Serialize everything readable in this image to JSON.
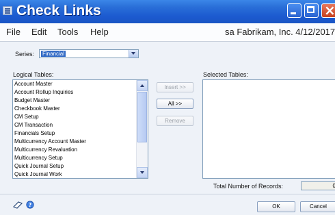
{
  "window": {
    "title": "Check Links"
  },
  "menu": {
    "items": [
      "File",
      "Edit",
      "Tools",
      "Help"
    ],
    "company_date": "sa Fabrikam, Inc. 4/12/2017"
  },
  "series": {
    "label": "Series:",
    "value": "Financial"
  },
  "logical_tables": {
    "label": "Logical Tables:",
    "items": [
      "Account Master",
      "Account Rollup Inquiries",
      "Budget Master",
      "Checkbook Master",
      "CM Setup",
      "CM Transaction",
      "Financials Setup",
      "Multicurrency Account Master",
      "Multicurrency Revaluation",
      "Multicurrency Setup",
      "Quick Journal Setup",
      "Quick Journal Work"
    ]
  },
  "actions": {
    "insert": "Insert >>",
    "all": "All >>",
    "remove": "Remove"
  },
  "selected_tables": {
    "label": "Selected Tables:"
  },
  "total": {
    "label": "Total Number of Records:",
    "value": "0"
  },
  "footer": {
    "ok": "OK",
    "cancel": "Cancel"
  }
}
